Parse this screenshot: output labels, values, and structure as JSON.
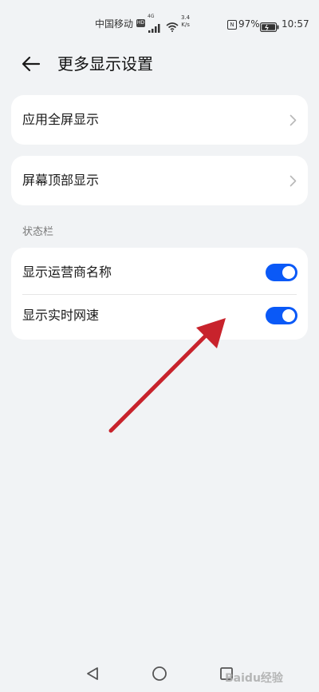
{
  "status_bar": {
    "carrier": "中国移动",
    "hd_badge": "HD",
    "network_type": "4G",
    "speed_value": "3.4",
    "speed_unit": "K/s",
    "nfc_label": "N",
    "battery_percent": "97%",
    "time": "10:57"
  },
  "header": {
    "title": "更多显示设置",
    "back_icon": "arrow-left-icon"
  },
  "cards": [
    {
      "label": "应用全屏显示",
      "icon": "chevron-right-icon"
    },
    {
      "label": "屏幕顶部显示",
      "icon": "chevron-right-icon"
    }
  ],
  "status_section": {
    "header": "状态栏",
    "items": [
      {
        "label": "显示运营商名称",
        "on": true
      },
      {
        "label": "显示实时网速",
        "on": true
      }
    ]
  },
  "nav": {
    "back_icon": "triangle-back-icon",
    "home_icon": "circle-home-icon",
    "recents_icon": "square-recents-icon"
  },
  "watermark": "Baidu经验",
  "colors": {
    "toggle_on": "#0a59f7",
    "annotation_arrow": "#c8232c",
    "background": "#f1f3f5"
  }
}
